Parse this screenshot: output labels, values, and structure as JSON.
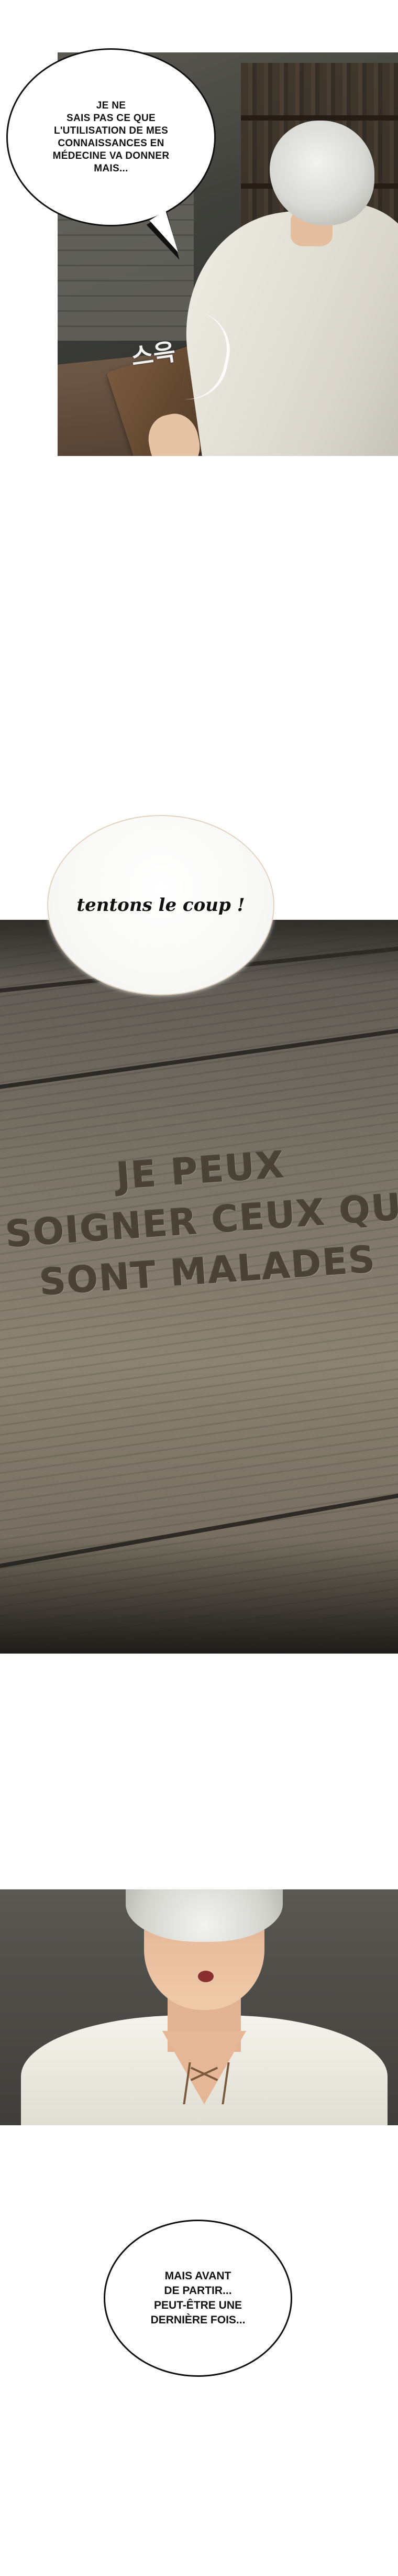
{
  "bubbles": {
    "bubble_1": "JE NE\nSAIS PAS CE QUE\nL'UTILISATION DE MES\nCONNAISSANCES EN\nMÉDECINE VA DONNER\nMAIS...",
    "thought": "tentons le coup !",
    "bubble_3": "MAIS AVANT\nDE PARTIR...\nPEUT-ÊTRE UNE\nDERNIÈRE FOIS..."
  },
  "sound_effect": "스윽",
  "carved_text": {
    "line_1": "JE PEUX",
    "line_2": "SOIGNER CEUX QUI",
    "line_3": "SONT MALADES"
  }
}
